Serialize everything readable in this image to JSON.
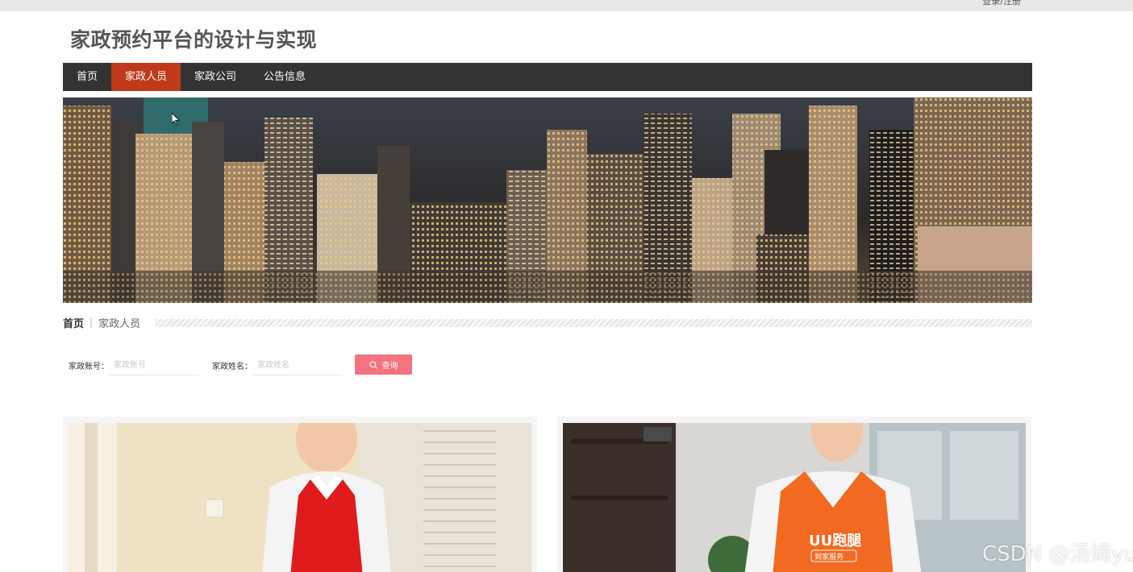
{
  "topbar": {
    "login_label": "登录/注册"
  },
  "site": {
    "title": "家政预约平台的设计与实现"
  },
  "nav": {
    "items": [
      {
        "label": "首页"
      },
      {
        "label": "家政人员"
      },
      {
        "label": "家政公司"
      },
      {
        "label": "公告信息"
      }
    ],
    "active_index": 1
  },
  "breadcrumb": {
    "home": "首页",
    "separator": "|",
    "current": "家政人员"
  },
  "search": {
    "account_label": "家政账号：",
    "account_placeholder": "家政账号",
    "name_label": "家政姓名：",
    "name_placeholder": "家政姓名",
    "button_label": "查询",
    "button_icon": "search-icon"
  },
  "cards": [
    {
      "image": "housekeeper-red-apron-photo"
    },
    {
      "image": "housekeeper-orange-vest-photo",
      "vest_text": "UU跑腿",
      "vest_subtext": "到家服务"
    }
  ],
  "watermark": "CSDN @汤姆yu",
  "colors": {
    "nav_bg": "#333333",
    "nav_active": "#c1391b",
    "search_button": "#f3747f",
    "card_bg": "#f5f5f5"
  }
}
